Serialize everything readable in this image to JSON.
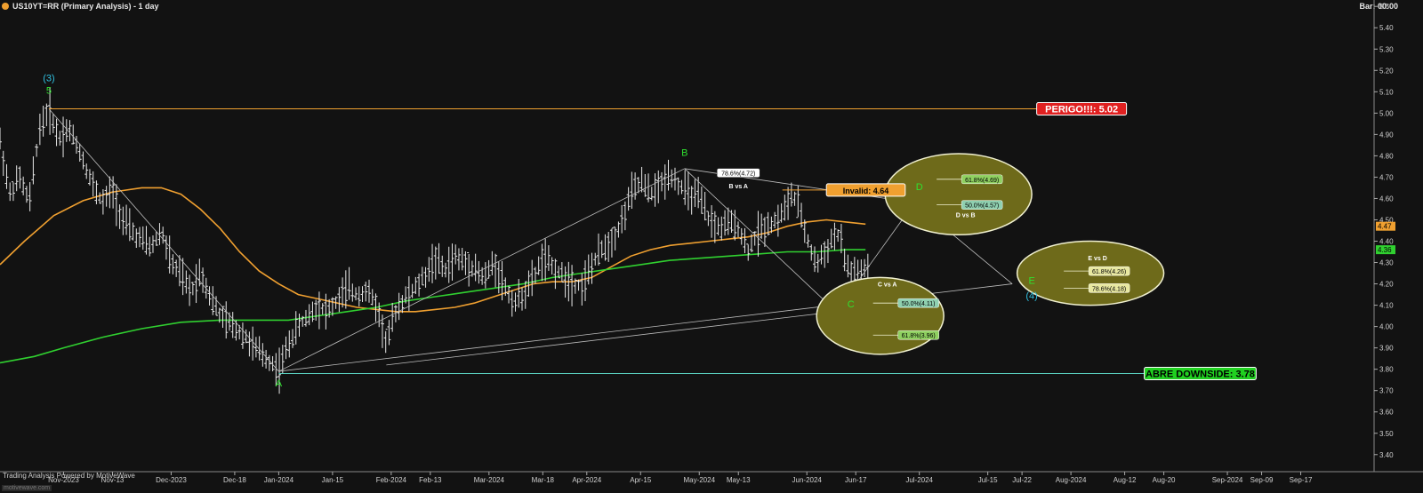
{
  "header": {
    "title": "US10YT=RR (Primary Analysis) - 1 day",
    "bar_label": "Bar: 00:00"
  },
  "footer": {
    "powered_by": "Trading Analysis Powered by MotiveWave",
    "brand": "motivewave.com"
  },
  "colors": {
    "background": "#121212",
    "price_bars": "#e8e8e8",
    "ma_fast": "#f0a030",
    "ma_slow": "#30d030",
    "wave_labels": "#30e030",
    "degree_labels": "#30c0e0",
    "danger": "#e02020",
    "upside_open": "#20d020",
    "invalid": "#f0a030",
    "target_ellipse": "#6e6a1a"
  },
  "chart_data": {
    "type": "line",
    "title": "US10YT=RR (Primary Analysis) - 1 day",
    "ylim": [
      3.32,
      5.53
    ],
    "y_axis_side": "right",
    "y_ticks": [
      3.4,
      3.5,
      3.6,
      3.7,
      3.8,
      3.9,
      4.0,
      4.1,
      4.2,
      4.3,
      4.4,
      4.5,
      4.6,
      4.7,
      4.8,
      4.9,
      5.0,
      5.1,
      5.2,
      5.3,
      5.4,
      5.5
    ],
    "y_tick_labels": [
      "3.40",
      "3.50",
      "3.60",
      "3.70",
      "3.80",
      "3.90",
      "4.00",
      "4.10",
      "4.20",
      "4.30",
      "4.40",
      "4.50",
      "4.60",
      "4.70",
      "4.80",
      "4.90",
      "5.00",
      "5.10",
      "5.20",
      "5.30",
      "5.40",
      "5.50"
    ],
    "x_ticks": [
      {
        "label": "Nov-2023",
        "x": 12
      },
      {
        "label": "Nov-13",
        "x": 22
      },
      {
        "label": "Dec-2023",
        "x": 34
      },
      {
        "label": "Dec-18",
        "x": 47
      },
      {
        "label": "Jan-2024",
        "x": 56
      },
      {
        "label": "Jan-15",
        "x": 67
      },
      {
        "label": "Feb-2024",
        "x": 79
      },
      {
        "label": "Feb-13",
        "x": 87
      },
      {
        "label": "Mar-2024",
        "x": 99
      },
      {
        "label": "Mar-18",
        "x": 110
      },
      {
        "label": "Apr-2024",
        "x": 119
      },
      {
        "label": "Apr-15",
        "x": 130
      },
      {
        "label": "May-2024",
        "x": 142
      },
      {
        "label": "May-13",
        "x": 150
      },
      {
        "label": "Jun-2024",
        "x": 164
      },
      {
        "label": "Jun-17",
        "x": 174
      },
      {
        "label": "Jul-2024",
        "x": 187
      },
      {
        "label": "Jul-15",
        "x": 201
      },
      {
        "label": "Jul-22",
        "x": 208
      },
      {
        "label": "Aug-2024",
        "x": 218
      },
      {
        "label": "Aug-12",
        "x": 229
      },
      {
        "label": "Aug-20",
        "x": 237
      },
      {
        "label": "Sep-2024",
        "x": 250
      },
      {
        "label": "Sep-09",
        "x": 257
      },
      {
        "label": "Sep-17",
        "x": 265
      }
    ],
    "x_range": [
      -1,
      280
    ],
    "last_bar_x": 177,
    "price_path": [
      [
        -1,
        4.87
      ],
      [
        1,
        4.62
      ],
      [
        3,
        4.7
      ],
      [
        5,
        4.58
      ],
      [
        7,
        4.92
      ],
      [
        9,
        5.02
      ],
      [
        11,
        4.88
      ],
      [
        13,
        4.93
      ],
      [
        15,
        4.84
      ],
      [
        18,
        4.66
      ],
      [
        20,
        4.58
      ],
      [
        22,
        4.64
      ],
      [
        24,
        4.5
      ],
      [
        27,
        4.42
      ],
      [
        30,
        4.37
      ],
      [
        32,
        4.45
      ],
      [
        34,
        4.3
      ],
      [
        36,
        4.24
      ],
      [
        38,
        4.16
      ],
      [
        40,
        4.26
      ],
      [
        42,
        4.14
      ],
      [
        44,
        4.05
      ],
      [
        46,
        4.01
      ],
      [
        49,
        3.96
      ],
      [
        51,
        3.9
      ],
      [
        53,
        3.86
      ],
      [
        55,
        3.82
      ],
      [
        56,
        3.79
      ],
      [
        58,
        3.92
      ],
      [
        60,
        4.0
      ],
      [
        62,
        4.05
      ],
      [
        64,
        4.1
      ],
      [
        66,
        4.07
      ],
      [
        68,
        4.12
      ],
      [
        70,
        4.18
      ],
      [
        72,
        4.15
      ],
      [
        74,
        4.17
      ],
      [
        76,
        4.1
      ],
      [
        78,
        3.92
      ],
      [
        80,
        4.08
      ],
      [
        82,
        4.14
      ],
      [
        84,
        4.18
      ],
      [
        86,
        4.24
      ],
      [
        88,
        4.32
      ],
      [
        90,
        4.26
      ],
      [
        92,
        4.33
      ],
      [
        94,
        4.3
      ],
      [
        96,
        4.28
      ],
      [
        98,
        4.22
      ],
      [
        100,
        4.3
      ],
      [
        102,
        4.2
      ],
      [
        104,
        4.11
      ],
      [
        106,
        4.15
      ],
      [
        108,
        4.22
      ],
      [
        110,
        4.32
      ],
      [
        112,
        4.28
      ],
      [
        114,
        4.24
      ],
      [
        116,
        4.21
      ],
      [
        118,
        4.19
      ],
      [
        120,
        4.28
      ],
      [
        122,
        4.36
      ],
      [
        124,
        4.4
      ],
      [
        126,
        4.48
      ],
      [
        128,
        4.62
      ],
      [
        130,
        4.68
      ],
      [
        132,
        4.62
      ],
      [
        134,
        4.66
      ],
      [
        136,
        4.72
      ],
      [
        138,
        4.66
      ],
      [
        140,
        4.62
      ],
      [
        142,
        4.6
      ],
      [
        144,
        4.5
      ],
      [
        146,
        4.46
      ],
      [
        148,
        4.48
      ],
      [
        150,
        4.47
      ],
      [
        151,
        4.4
      ],
      [
        152,
        4.36
      ],
      [
        154,
        4.44
      ],
      [
        156,
        4.48
      ],
      [
        158,
        4.5
      ],
      [
        160,
        4.57
      ],
      [
        161,
        4.62
      ],
      [
        162,
        4.58
      ],
      [
        164,
        4.42
      ],
      [
        165,
        4.34
      ],
      [
        166,
        4.29
      ],
      [
        168,
        4.36
      ],
      [
        170,
        4.44
      ],
      [
        171,
        4.4
      ],
      [
        172,
        4.28
      ],
      [
        174,
        4.24
      ],
      [
        175,
        4.26
      ],
      [
        177,
        4.26
      ]
    ],
    "series": [
      {
        "name": "",
        "color": "#f0a030",
        "points": [
          [
            -1,
            4.29
          ],
          [
            4,
            4.4
          ],
          [
            10,
            4.52
          ],
          [
            16,
            4.59
          ],
          [
            22,
            4.63
          ],
          [
            28,
            4.65
          ],
          [
            32,
            4.65
          ],
          [
            36,
            4.62
          ],
          [
            40,
            4.55
          ],
          [
            44,
            4.46
          ],
          [
            48,
            4.35
          ],
          [
            52,
            4.26
          ],
          [
            56,
            4.2
          ],
          [
            60,
            4.15
          ],
          [
            64,
            4.13
          ],
          [
            68,
            4.11
          ],
          [
            72,
            4.09
          ],
          [
            76,
            4.08
          ],
          [
            80,
            4.07
          ],
          [
            84,
            4.07
          ],
          [
            88,
            4.08
          ],
          [
            92,
            4.09
          ],
          [
            96,
            4.11
          ],
          [
            100,
            4.14
          ],
          [
            104,
            4.17
          ],
          [
            108,
            4.2
          ],
          [
            112,
            4.21
          ],
          [
            116,
            4.21
          ],
          [
            120,
            4.23
          ],
          [
            124,
            4.28
          ],
          [
            128,
            4.33
          ],
          [
            132,
            4.36
          ],
          [
            136,
            4.38
          ],
          [
            140,
            4.39
          ],
          [
            144,
            4.4
          ],
          [
            148,
            4.41
          ],
          [
            152,
            4.42
          ],
          [
            156,
            4.44
          ],
          [
            160,
            4.47
          ],
          [
            164,
            4.49
          ],
          [
            168,
            4.5
          ],
          [
            172,
            4.49
          ],
          [
            176,
            4.48
          ]
        ]
      },
      {
        "name": "",
        "color": "#30d030",
        "points": [
          [
            -1,
            3.83
          ],
          [
            6,
            3.86
          ],
          [
            12,
            3.9
          ],
          [
            20,
            3.95
          ],
          [
            28,
            3.99
          ],
          [
            36,
            4.02
          ],
          [
            44,
            4.03
          ],
          [
            52,
            4.03
          ],
          [
            58,
            4.03
          ],
          [
            64,
            4.05
          ],
          [
            70,
            4.07
          ],
          [
            76,
            4.09
          ],
          [
            82,
            4.12
          ],
          [
            88,
            4.14
          ],
          [
            94,
            4.16
          ],
          [
            100,
            4.18
          ],
          [
            106,
            4.2
          ],
          [
            112,
            4.23
          ],
          [
            118,
            4.25
          ],
          [
            124,
            4.27
          ],
          [
            130,
            4.29
          ],
          [
            136,
            4.31
          ],
          [
            142,
            4.32
          ],
          [
            148,
            4.33
          ],
          [
            154,
            4.34
          ],
          [
            160,
            4.35
          ],
          [
            166,
            4.35
          ],
          [
            172,
            4.36
          ],
          [
            176,
            4.36
          ]
        ]
      }
    ],
    "last_values": [
      {
        "label": "4.47",
        "y": 4.47,
        "color": "#f0a030"
      },
      {
        "label": "4.36",
        "y": 4.36,
        "color": "#30d030"
      }
    ],
    "wave_lines": [
      [
        [
          9,
          5.02
        ],
        [
          56,
          3.79
        ]
      ],
      [
        [
          56,
          3.79
        ],
        [
          139,
          4.74
        ]
      ],
      [
        [
          139,
          4.74
        ],
        [
          170,
          4.07
        ]
      ],
      [
        [
          170,
          4.07
        ],
        [
          186,
          4.58
        ]
      ],
      [
        [
          186,
          4.58
        ],
        [
          206,
          4.2
        ]
      ],
      [
        [
          56,
          3.79
        ],
        [
          206,
          4.2
        ]
      ],
      [
        [
          78,
          3.82
        ],
        [
          170,
          4.07
        ]
      ],
      [
        [
          139,
          4.74
        ],
        [
          186,
          4.58
        ]
      ]
    ],
    "horizontal_levels": [
      {
        "label": "PERIGO!!!: 5.02",
        "value": 5.02,
        "from": 9,
        "to": 211,
        "line_color": "#f0a030",
        "box_color": "#e02020",
        "text_color": "#ffffff"
      },
      {
        "label": "ABRE DOWNSIDE: 3.78",
        "value": 3.78,
        "from": 56,
        "to": 233,
        "line_color": "#5ad0c0",
        "box_color": "#20d020",
        "text_color": "#000000"
      },
      {
        "label": "Invalid: 4.64",
        "value": 4.64,
        "from": 159,
        "to": 168,
        "line_color": "#f0a030",
        "box_color": "#f0a030",
        "text_color": "#000000"
      }
    ],
    "wave_labels": [
      {
        "text": "(3)",
        "x": 9,
        "y": 5.15,
        "color": "#30c0e0"
      },
      {
        "text": "5",
        "x": 9,
        "y": 5.09,
        "color": "#30e030"
      },
      {
        "text": "A",
        "x": 56,
        "y": 3.72,
        "color": "#30e030"
      },
      {
        "text": "B",
        "x": 139,
        "y": 4.8,
        "color": "#30e030"
      },
      {
        "text": "C",
        "x": 173,
        "y": 4.09,
        "color": "#30e030"
      },
      {
        "text": "D",
        "x": 187,
        "y": 4.64,
        "color": "#30e030"
      },
      {
        "text": "E",
        "x": 210,
        "y": 4.2,
        "color": "#30e030"
      },
      {
        "text": "(4)",
        "x": 210,
        "y": 4.13,
        "color": "#30c0e0"
      }
    ],
    "target_zones": [
      {
        "cx": 179,
        "cy": 4.05,
        "rx": 13,
        "ry": 0.18,
        "title": "C vs A",
        "levels": [
          {
            "label": "50.0%(4.11)",
            "x": 183,
            "y": 4.11,
            "box": "#8fd0b0"
          },
          {
            "label": "61.8%(3.96)",
            "x": 183,
            "y": 3.96,
            "box": "#8fd060"
          }
        ]
      },
      {
        "cx": 195,
        "cy": 4.62,
        "rx": 15,
        "ry": 0.19,
        "title": "D vs B",
        "levels": [
          {
            "label": "61.8%(4.69)",
            "x": 196,
            "y": 4.69,
            "box": "#8fd060"
          },
          {
            "label": "50.0%(4.57)",
            "x": 196,
            "y": 4.57,
            "box": "#8fd0b0"
          }
        ]
      },
      {
        "cx": 222,
        "cy": 4.25,
        "rx": 15,
        "ry": 0.15,
        "title": "E vs D",
        "levels": [
          {
            "label": "61.8%(4.26)",
            "x": 222,
            "y": 4.26,
            "box": "#e8e8a0"
          },
          {
            "label": "78.6%(4.18)",
            "x": 222,
            "y": 4.18,
            "box": "#e8e8a0"
          }
        ]
      }
    ],
    "annotations": [
      {
        "label": "78.6%(4.72)",
        "x": 150,
        "y": 4.72,
        "box": "#ffffff"
      }
    ],
    "annotation_titles": [
      {
        "text": "B vs A",
        "x": 150,
        "y": 4.66
      }
    ]
  }
}
